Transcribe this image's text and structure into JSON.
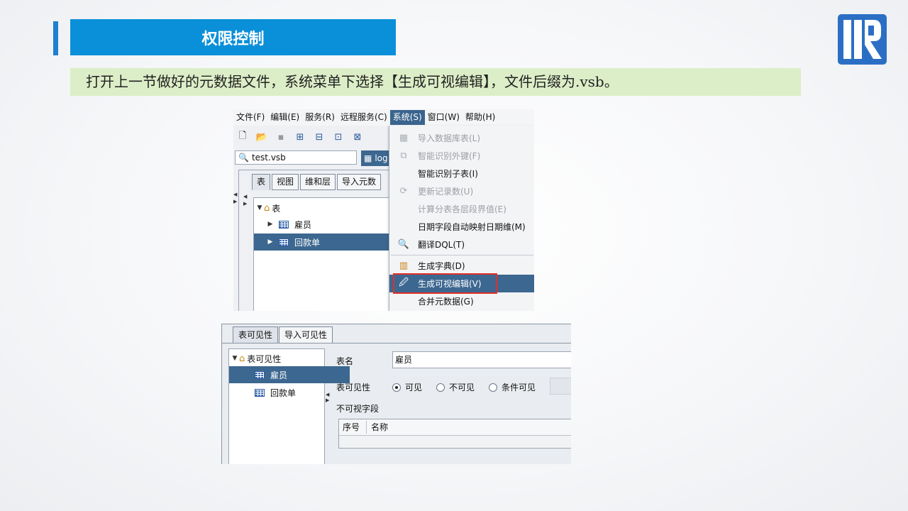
{
  "header": {
    "title": "权限控制",
    "caption": "打开上一节做好的元数据文件，系统菜单下选择【生成可视编辑】，文件后缀为.vsb。",
    "logo_icon": "r-logo-icon",
    "accent_color": "#0a8fd9"
  },
  "screenshot1": {
    "menu": [
      "文件(F)",
      "编辑(E)",
      "服务(R)",
      "远程服务(C)",
      "系统(S)",
      "窗口(W)",
      "帮助(H)"
    ],
    "active_menu": "系统(S)",
    "file_tab": "test.vsb",
    "file_tab2": "log",
    "tabs": [
      "表",
      "视图",
      "维和层",
      "导入元数"
    ],
    "tree": {
      "root": "表",
      "children": [
        "雇员",
        "回款单"
      ],
      "selected": "回款单"
    },
    "dropdown": [
      {
        "label": "导入数据库表(L)",
        "enabled": false,
        "icon": "import-table-icon"
      },
      {
        "label": "智能识别外键(F)",
        "enabled": false,
        "icon": "foreign-key-icon"
      },
      {
        "label": "智能识别子表(I)",
        "enabled": true,
        "icon": ""
      },
      {
        "label": "更新记录数(U)",
        "enabled": false,
        "icon": "refresh-icon"
      },
      {
        "label": "计算分表各层段界值(E)",
        "enabled": false,
        "icon": ""
      },
      {
        "label": "日期字段自动映射日期维(M)",
        "enabled": true,
        "icon": ""
      },
      {
        "label": "翻译DQL(T)",
        "enabled": true,
        "icon": "translate-icon"
      },
      {
        "label": "生成字典(D)",
        "enabled": true,
        "icon": "dictionary-icon"
      },
      {
        "label": "生成可视编辑(V)",
        "enabled": true,
        "icon": "visual-edit-icon",
        "highlighted": true
      },
      {
        "label": "合并元数据(G)",
        "enabled": true,
        "icon": ""
      }
    ]
  },
  "screenshot2": {
    "tabs": [
      "表可见性",
      "导入可见性"
    ],
    "tree": {
      "root": "表可见性",
      "children": [
        "雇员",
        "回款单"
      ],
      "selected": "雇员"
    },
    "table_name_label": "表名",
    "table_name_value": "雇员",
    "visibility_label": "表可见性",
    "radios": [
      "可见",
      "不可见",
      "条件可见"
    ],
    "selected_radio": "可见",
    "invisible_fields_label": "不可视字段",
    "columns": [
      "序号",
      "名称"
    ]
  }
}
